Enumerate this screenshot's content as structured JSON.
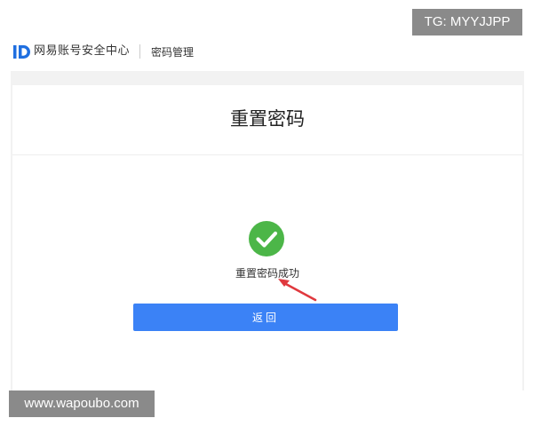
{
  "header": {
    "brand": "网易账号安全中心",
    "section": "密码管理"
  },
  "card": {
    "title": "重置密码",
    "success_message": "重置密码成功",
    "back_button_label": "返回"
  },
  "watermarks": {
    "top": "TG: MYYJJPP",
    "bottom": "www.wapoubo.com"
  },
  "colors": {
    "brand_blue": "#1f6fe0",
    "success_green": "#4cb648",
    "button_blue": "#3b82f6",
    "arrow_red": "#e0393e"
  },
  "icons": {
    "logo": "netease-id-logo",
    "success": "check-circle-icon",
    "annotation": "red-arrow-annotation"
  }
}
